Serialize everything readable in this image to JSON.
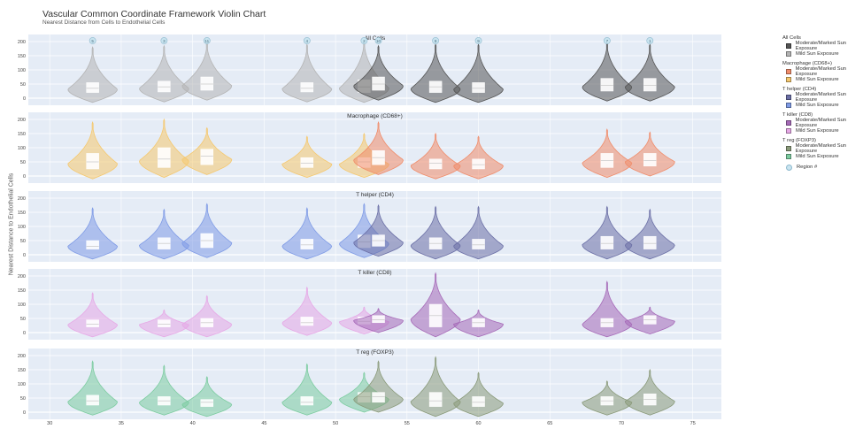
{
  "title": "Vascular Common Coordinate Framework Violin Chart",
  "subtitle": "Nearest Distance from Cells to Endothelial Cells",
  "ylabel": "Nearest Distance to Endothelial Cells",
  "legend": {
    "groups": [
      {
        "title": "All Cells",
        "items": [
          {
            "label": "Moderate/Marked Sun Exposure",
            "color": "#555555"
          },
          {
            "label": "Mild Sun Exposure",
            "color": "#b4b4b4"
          }
        ]
      },
      {
        "title": "Macrophage (CD68+)",
        "items": [
          {
            "label": "Moderate/Marked Sun Exposure",
            "color": "#f08c6a"
          },
          {
            "label": "Mild Sun Exposure",
            "color": "#f5c86e"
          }
        ]
      },
      {
        "title": "T helper (CD4)",
        "items": [
          {
            "label": "Moderate/Marked Sun Exposure",
            "color": "#6b6fa6"
          },
          {
            "label": "Mild Sun Exposure",
            "color": "#7f9be6"
          }
        ]
      },
      {
        "title": "T killer (CD8)",
        "items": [
          {
            "label": "Moderate/Marked Sun Exposure",
            "color": "#a66ab8"
          },
          {
            "label": "Mild Sun Exposure",
            "color": "#e6a8e6"
          }
        ]
      },
      {
        "title": "T reg (FOXP3)",
        "items": [
          {
            "label": "Moderate/Marked Sun Exposure",
            "color": "#8a9a7a"
          },
          {
            "label": "Mild Sun Exposure",
            "color": "#7ccca0"
          }
        ]
      }
    ],
    "region_label": "Region #",
    "region_color": "#c9e4f0"
  },
  "chart_data": {
    "type": "violin",
    "xlim": [
      28.5,
      77
    ],
    "xticks": [
      30,
      35,
      40,
      45,
      50,
      55,
      60,
      65,
      70,
      75
    ],
    "ylim": [
      -25,
      225
    ],
    "yticks": [
      0,
      50,
      100,
      150,
      200
    ],
    "regions": [
      {
        "x": 33,
        "label": "5"
      },
      {
        "x": 38,
        "label": "3"
      },
      {
        "x": 41,
        "label": "11"
      },
      {
        "x": 48,
        "label": "4"
      },
      {
        "x": 52,
        "label": "2"
      },
      {
        "x": 53,
        "label": "10"
      },
      {
        "x": 57,
        "label": "8"
      },
      {
        "x": 60,
        "label": "9"
      },
      {
        "x": 69,
        "label": "7"
      },
      {
        "x": 72,
        "label": "1"
      }
    ],
    "panels": [
      {
        "title": "All Cells",
        "mod_color": "#555555",
        "mild_color": "#b4b4b4",
        "violins": [
          {
            "x": 33,
            "exposure": "mild",
            "median": 35,
            "q1": 20,
            "q3": 55,
            "max": 180
          },
          {
            "x": 38,
            "exposure": "mild",
            "median": 40,
            "q1": 22,
            "q3": 60,
            "max": 185
          },
          {
            "x": 41,
            "exposure": "mild",
            "median": 50,
            "q1": 28,
            "q3": 75,
            "max": 200
          },
          {
            "x": 48,
            "exposure": "mild",
            "median": 35,
            "q1": 22,
            "q3": 55,
            "max": 190
          },
          {
            "x": 52,
            "exposure": "mild",
            "median": 40,
            "q1": 20,
            "q3": 65,
            "max": 210
          },
          {
            "x": 53,
            "exposure": "moderate",
            "median": 50,
            "q1": 28,
            "q3": 75,
            "max": 185
          },
          {
            "x": 57,
            "exposure": "moderate",
            "median": 40,
            "q1": 20,
            "q3": 60,
            "max": 190
          },
          {
            "x": 60,
            "exposure": "moderate",
            "median": 35,
            "q1": 20,
            "q3": 55,
            "max": 190
          },
          {
            "x": 69,
            "exposure": "moderate",
            "median": 45,
            "q1": 25,
            "q3": 70,
            "max": 200
          },
          {
            "x": 72,
            "exposure": "moderate",
            "median": 45,
            "q1": 25,
            "q3": 70,
            "max": 190
          }
        ]
      },
      {
        "title": "Macrophage (CD68+)",
        "mod_color": "#f08c6a",
        "mild_color": "#f5c86e",
        "violins": [
          {
            "x": 33,
            "exposure": "mild",
            "median": 50,
            "q1": 25,
            "q3": 80,
            "max": 190
          },
          {
            "x": 38,
            "exposure": "mild",
            "median": 60,
            "q1": 30,
            "q3": 100,
            "max": 200
          },
          {
            "x": 41,
            "exposure": "mild",
            "median": 70,
            "q1": 40,
            "q3": 95,
            "max": 170
          },
          {
            "x": 48,
            "exposure": "mild",
            "median": 45,
            "q1": 30,
            "q3": 65,
            "max": 140
          },
          {
            "x": 52,
            "exposure": "mild",
            "median": 50,
            "q1": 30,
            "q3": 65,
            "max": 150
          },
          {
            "x": 53,
            "exposure": "moderate",
            "median": 65,
            "q1": 40,
            "q3": 90,
            "max": 190
          },
          {
            "x": 57,
            "exposure": "moderate",
            "median": 45,
            "q1": 25,
            "q3": 60,
            "max": 150
          },
          {
            "x": 60,
            "exposure": "moderate",
            "median": 40,
            "q1": 25,
            "q3": 60,
            "max": 140
          },
          {
            "x": 69,
            "exposure": "moderate",
            "median": 55,
            "q1": 30,
            "q3": 80,
            "max": 165
          },
          {
            "x": 72,
            "exposure": "moderate",
            "median": 55,
            "q1": 35,
            "q3": 80,
            "max": 155
          }
        ]
      },
      {
        "title": "T helper (CD4)",
        "mod_color": "#6b6fa6",
        "mild_color": "#7f9be6",
        "violins": [
          {
            "x": 33,
            "exposure": "mild",
            "median": 30,
            "q1": 20,
            "q3": 50,
            "max": 165
          },
          {
            "x": 38,
            "exposure": "mild",
            "median": 40,
            "q1": 20,
            "q3": 60,
            "max": 160
          },
          {
            "x": 41,
            "exposure": "mild",
            "median": 50,
            "q1": 25,
            "q3": 75,
            "max": 180
          },
          {
            "x": 48,
            "exposure": "mild",
            "median": 35,
            "q1": 20,
            "q3": 55,
            "max": 165
          },
          {
            "x": 52,
            "exposure": "mild",
            "median": 45,
            "q1": 25,
            "q3": 70,
            "max": 180
          },
          {
            "x": 53,
            "exposure": "moderate",
            "median": 50,
            "q1": 30,
            "q3": 70,
            "max": 175
          },
          {
            "x": 57,
            "exposure": "moderate",
            "median": 40,
            "q1": 20,
            "q3": 60,
            "max": 170
          },
          {
            "x": 60,
            "exposure": "moderate",
            "median": 35,
            "q1": 20,
            "q3": 55,
            "max": 170
          },
          {
            "x": 69,
            "exposure": "moderate",
            "median": 40,
            "q1": 20,
            "q3": 65,
            "max": 170
          },
          {
            "x": 72,
            "exposure": "moderate",
            "median": 40,
            "q1": 20,
            "q3": 65,
            "max": 160
          }
        ]
      },
      {
        "title": "T killer (CD8)",
        "mod_color": "#a66ab8",
        "mild_color": "#e6a8e6",
        "violins": [
          {
            "x": 33,
            "exposure": "mild",
            "median": 30,
            "q1": 20,
            "q3": 45,
            "max": 140
          },
          {
            "x": 38,
            "exposure": "mild",
            "median": 30,
            "q1": 20,
            "q3": 45,
            "max": 80
          },
          {
            "x": 41,
            "exposure": "mild",
            "median": 35,
            "q1": 20,
            "q3": 50,
            "max": 130
          },
          {
            "x": 48,
            "exposure": "mild",
            "median": 35,
            "q1": 25,
            "q3": 55,
            "max": 160
          },
          {
            "x": 52,
            "exposure": "mild",
            "median": 40,
            "q1": 30,
            "q3": 55,
            "max": 90
          },
          {
            "x": 53,
            "exposure": "moderate",
            "median": 45,
            "q1": 35,
            "q3": 60,
            "max": 85
          },
          {
            "x": 57,
            "exposure": "moderate",
            "median": 60,
            "q1": 20,
            "q3": 100,
            "max": 210
          },
          {
            "x": 60,
            "exposure": "moderate",
            "median": 35,
            "q1": 20,
            "q3": 50,
            "max": 80
          },
          {
            "x": 69,
            "exposure": "moderate",
            "median": 35,
            "q1": 20,
            "q3": 50,
            "max": 180
          },
          {
            "x": 72,
            "exposure": "moderate",
            "median": 45,
            "q1": 30,
            "q3": 60,
            "max": 90
          }
        ]
      },
      {
        "title": "T reg (FOXP3)",
        "mod_color": "#8a9a7a",
        "mild_color": "#7ccca0",
        "violins": [
          {
            "x": 33,
            "exposure": "mild",
            "median": 40,
            "q1": 25,
            "q3": 60,
            "max": 180
          },
          {
            "x": 38,
            "exposure": "mild",
            "median": 40,
            "q1": 25,
            "q3": 55,
            "max": 165
          },
          {
            "x": 41,
            "exposure": "mild",
            "median": 35,
            "q1": 20,
            "q3": 45,
            "max": 125
          },
          {
            "x": 48,
            "exposure": "mild",
            "median": 35,
            "q1": 25,
            "q3": 55,
            "max": 170
          },
          {
            "x": 52,
            "exposure": "mild",
            "median": 55,
            "q1": 35,
            "q3": 70,
            "max": 140
          },
          {
            "x": 53,
            "exposure": "moderate",
            "median": 55,
            "q1": 35,
            "q3": 70,
            "max": 180
          },
          {
            "x": 57,
            "exposure": "moderate",
            "median": 40,
            "q1": 20,
            "q3": 70,
            "max": 195
          },
          {
            "x": 60,
            "exposure": "moderate",
            "median": 35,
            "q1": 20,
            "q3": 55,
            "max": 140
          },
          {
            "x": 69,
            "exposure": "moderate",
            "median": 40,
            "q1": 25,
            "q3": 55,
            "max": 110
          },
          {
            "x": 72,
            "exposure": "moderate",
            "median": 45,
            "q1": 25,
            "q3": 65,
            "max": 150
          }
        ]
      }
    ]
  }
}
